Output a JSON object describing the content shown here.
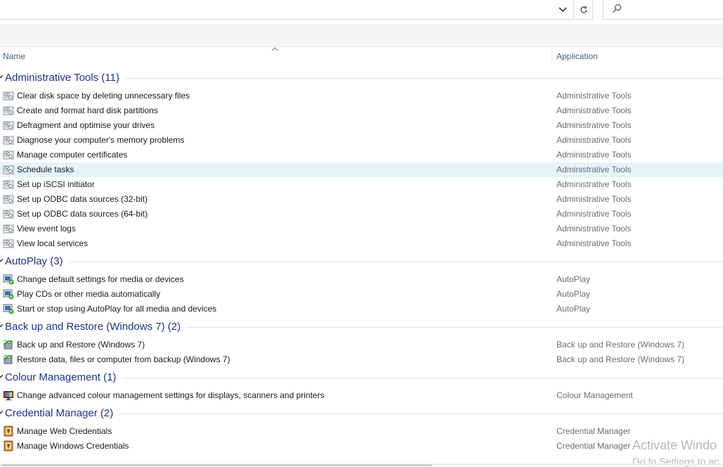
{
  "address": {
    "value": ""
  },
  "search": {
    "placeholder": ""
  },
  "columns": {
    "name": "Name",
    "application": "Application"
  },
  "groups": [
    {
      "title": "Administrative Tools (11)",
      "icon": "admin-tools-icon",
      "items": [
        {
          "name": "Clear disk space by deleting unnecessary files",
          "app": "Administrative Tools"
        },
        {
          "name": "Create and format hard disk partitions",
          "app": "Administrative Tools"
        },
        {
          "name": "Defragment and optimise your drives",
          "app": "Administrative Tools"
        },
        {
          "name": "Diagnose your computer's memory problems",
          "app": "Administrative Tools"
        },
        {
          "name": "Manage computer certificates",
          "app": "Administrative Tools"
        },
        {
          "name": "Schedule tasks",
          "app": "Administrative Tools",
          "selected": true
        },
        {
          "name": "Set up iSCSI initiator",
          "app": "Administrative Tools"
        },
        {
          "name": "Set up ODBC data sources (32-bit)",
          "app": "Administrative Tools"
        },
        {
          "name": "Set up ODBC data sources (64-bit)",
          "app": "Administrative Tools"
        },
        {
          "name": "View event logs",
          "app": "Administrative Tools"
        },
        {
          "name": "View local services",
          "app": "Administrative Tools"
        }
      ]
    },
    {
      "title": "AutoPlay (3)",
      "icon": "autoplay-icon",
      "items": [
        {
          "name": "Change default settings for media or devices",
          "app": "AutoPlay"
        },
        {
          "name": "Play CDs or other media automatically",
          "app": "AutoPlay"
        },
        {
          "name": "Start or stop using AutoPlay for all media and devices",
          "app": "AutoPlay"
        }
      ]
    },
    {
      "title": "Back up and Restore (Windows 7) (2)",
      "icon": "backup-restore-icon",
      "items": [
        {
          "name": "Back up and Restore (Windows 7)",
          "app": "Back up and Restore (Windows 7)"
        },
        {
          "name": "Restore data, files or computer from backup (Windows 7)",
          "app": "Back up and Restore (Windows 7)"
        }
      ]
    },
    {
      "title": "Colour Management (1)",
      "icon": "colour-management-icon",
      "items": [
        {
          "name": "Change advanced colour management settings for displays, scanners and printers",
          "app": "Colour Management"
        }
      ]
    },
    {
      "title": "Credential Manager (2)",
      "icon": "credential-manager-icon",
      "items": [
        {
          "name": "Manage Web Credentials",
          "app": "Credential Manager"
        },
        {
          "name": "Manage Windows Credentials",
          "app": "Credential Manager"
        }
      ]
    }
  ],
  "watermark": {
    "line1": "Activate Windo",
    "line2": "Go to Settings to ac"
  },
  "colors": {
    "group_title": "#1e3287",
    "selected_row": "#e5f3fb",
    "app_text": "#6d6d6d"
  }
}
